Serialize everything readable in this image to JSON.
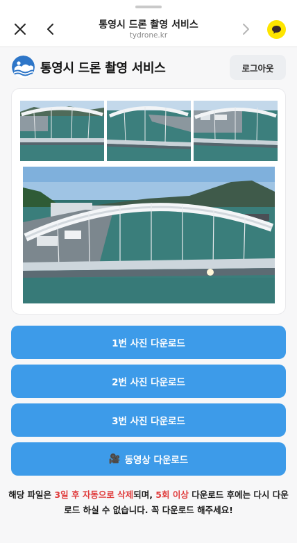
{
  "nav": {
    "title": "통영시 드론 촬영 서비스",
    "url": "tydrone.kr",
    "close_icon": "close-icon",
    "back_icon": "chevron-left-icon",
    "forward_icon": "chevron-right-icon",
    "talk_icon": "chat-bubble-icon"
  },
  "header": {
    "site_title": "통영시 드론 촬영 서비스",
    "logout_label": "로그아웃"
  },
  "photos": {
    "thumbnails": [
      "photo-1",
      "photo-2",
      "photo-3"
    ],
    "main": "photo-main"
  },
  "buttons": {
    "photo1": "1번 사진 다운로드",
    "photo2": "2번 사진 다운로드",
    "photo3": "3번 사진 다운로드",
    "video_icon": "🎥",
    "video": "동영상 다운로드"
  },
  "notice": {
    "part1": "해당 파일은 ",
    "red1": "3일 후 자동으로 삭제",
    "part2": "되며, ",
    "red2": "5회 이상",
    "part3": " 다운로드 후에는 다시 다운로드 하실 수 없습니다. 꼭 다운로드 해주세요!"
  },
  "colors": {
    "accent": "#3d9be9",
    "warning": "#e03b3b",
    "kakao_yellow": "#fee500"
  }
}
